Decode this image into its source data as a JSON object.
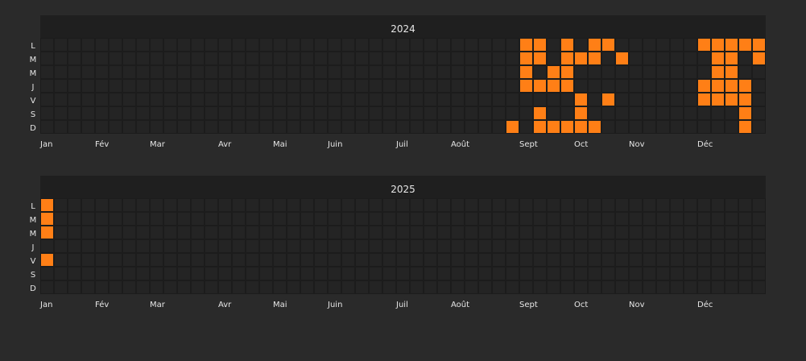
{
  "chart_data": [
    {
      "type": "heatmap",
      "title": "2024",
      "weeks": 53,
      "day_labels": [
        "L",
        "M",
        "M",
        "J",
        "V",
        "S",
        "D"
      ],
      "month_labels": [
        {
          "label": "Jan",
          "week": 0
        },
        {
          "label": "Fév",
          "week": 4
        },
        {
          "label": "Mar",
          "week": 8
        },
        {
          "label": "Avr",
          "week": 13
        },
        {
          "label": "Mai",
          "week": 17
        },
        {
          "label": "Juin",
          "week": 21
        },
        {
          "label": "Juil",
          "week": 26
        },
        {
          "label": "Août",
          "week": 30
        },
        {
          "label": "Sept",
          "week": 35
        },
        {
          "label": "Oct",
          "week": 39
        },
        {
          "label": "Nov",
          "week": 43
        },
        {
          "label": "Déc",
          "week": 48
        }
      ],
      "active_color": "#ff7f16",
      "empty_color": "#242424",
      "active_cells": [
        [
          34,
          6
        ],
        [
          35,
          0
        ],
        [
          35,
          1
        ],
        [
          35,
          2
        ],
        [
          35,
          3
        ],
        [
          36,
          0
        ],
        [
          36,
          1
        ],
        [
          36,
          3
        ],
        [
          36,
          5
        ],
        [
          36,
          6
        ],
        [
          37,
          2
        ],
        [
          37,
          3
        ],
        [
          37,
          6
        ],
        [
          38,
          0
        ],
        [
          38,
          1
        ],
        [
          38,
          2
        ],
        [
          38,
          3
        ],
        [
          38,
          6
        ],
        [
          39,
          1
        ],
        [
          39,
          4
        ],
        [
          39,
          5
        ],
        [
          39,
          6
        ],
        [
          40,
          0
        ],
        [
          40,
          1
        ],
        [
          40,
          6
        ],
        [
          41,
          0
        ],
        [
          41,
          4
        ],
        [
          42,
          1
        ],
        [
          48,
          0
        ],
        [
          48,
          3
        ],
        [
          48,
          4
        ],
        [
          49,
          0
        ],
        [
          49,
          1
        ],
        [
          49,
          2
        ],
        [
          49,
          3
        ],
        [
          49,
          4
        ],
        [
          50,
          0
        ],
        [
          50,
          1
        ],
        [
          50,
          2
        ],
        [
          50,
          3
        ],
        [
          50,
          4
        ],
        [
          51,
          0
        ],
        [
          51,
          3
        ],
        [
          51,
          4
        ],
        [
          51,
          5
        ],
        [
          51,
          6
        ],
        [
          52,
          0
        ],
        [
          52,
          1
        ]
      ]
    },
    {
      "type": "heatmap",
      "title": "2025",
      "weeks": 53,
      "day_labels": [
        "L",
        "M",
        "M",
        "J",
        "V",
        "S",
        "D"
      ],
      "month_labels": [
        {
          "label": "Jan",
          "week": 0
        },
        {
          "label": "Fév",
          "week": 4
        },
        {
          "label": "Mar",
          "week": 8
        },
        {
          "label": "Avr",
          "week": 13
        },
        {
          "label": "Mai",
          "week": 17
        },
        {
          "label": "Juin",
          "week": 21
        },
        {
          "label": "Juil",
          "week": 26
        },
        {
          "label": "Août",
          "week": 30
        },
        {
          "label": "Sept",
          "week": 35
        },
        {
          "label": "Oct",
          "week": 39
        },
        {
          "label": "Nov",
          "week": 43
        },
        {
          "label": "Déc",
          "week": 48
        }
      ],
      "active_color": "#ff7f16",
      "empty_color": "#242424",
      "active_cells": [
        [
          0,
          0
        ],
        [
          0,
          1
        ],
        [
          0,
          2
        ],
        [
          0,
          4
        ]
      ]
    }
  ]
}
